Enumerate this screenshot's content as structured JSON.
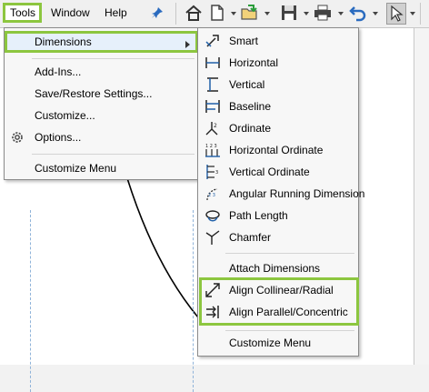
{
  "menubar": {
    "items": [
      {
        "label": "Tools"
      },
      {
        "label": "Window"
      },
      {
        "label": "Help"
      }
    ]
  },
  "toolbar": {
    "icons": [
      "home-icon",
      "new-document-icon",
      "open-folder-icon",
      "save-icon",
      "print-icon",
      "undo-icon",
      "select-pointer-icon"
    ]
  },
  "tools_menu": {
    "items": [
      {
        "label": "Dimensions"
      },
      {
        "label": "Add-Ins..."
      },
      {
        "label": "Save/Restore Settings..."
      },
      {
        "label": "Customize..."
      },
      {
        "label": "Options..."
      },
      {
        "label": "Customize Menu"
      }
    ]
  },
  "dimensions_menu": {
    "items": [
      {
        "label": "Smart"
      },
      {
        "label": "Horizontal"
      },
      {
        "label": "Vertical"
      },
      {
        "label": "Baseline"
      },
      {
        "label": "Ordinate"
      },
      {
        "label": "Horizontal Ordinate"
      },
      {
        "label": "Vertical Ordinate"
      },
      {
        "label": "Angular Running Dimension"
      },
      {
        "label": "Path Length"
      },
      {
        "label": "Chamfer"
      },
      {
        "label": "Attach Dimensions"
      },
      {
        "label": "Align Collinear/Radial"
      },
      {
        "label": "Align Parallel/Concentric"
      },
      {
        "label": "Customize Menu"
      }
    ]
  },
  "colors": {
    "highlight_border": "#8cc63f",
    "menu_bg": "#f7f7f7",
    "icon_blue": "#1f5fa8"
  }
}
